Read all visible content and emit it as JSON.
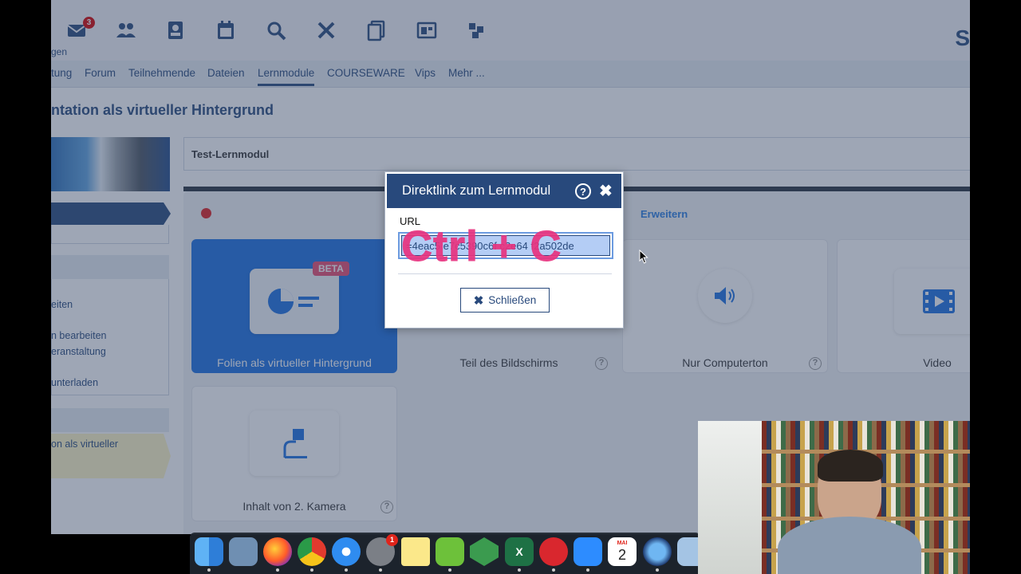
{
  "topbar": {
    "mail_badge": "3",
    "sub_label": "gen",
    "logo_text": "S",
    "icons": [
      "mail-icon",
      "people-icon",
      "profile-icon",
      "calendar-icon",
      "search-icon",
      "tools-icon",
      "files-icon",
      "admin-icon",
      "groups-icon"
    ]
  },
  "nav": {
    "tabs": [
      {
        "label": "tung"
      },
      {
        "label": "Forum"
      },
      {
        "label": "Teilnehmende"
      },
      {
        "label": "Dateien"
      },
      {
        "label": "Lernmodule",
        "active": true
      },
      {
        "label": "COURSEWARE"
      },
      {
        "label": "Vips"
      },
      {
        "label": "Mehr ..."
      }
    ]
  },
  "page": {
    "title": "ntation als virtueller Hintergrund"
  },
  "sidebar": {
    "links": [
      "eiten",
      "n bearbeiten",
      "eranstaltung",
      "unterladen"
    ],
    "selected_item": "on als virtueller"
  },
  "module": {
    "name": "Test-Lernmodul",
    "erweitern": "Erweitern",
    "beta": "BETA",
    "cards": [
      {
        "label": "Folien als virtueller Hintergrund",
        "selected": true
      },
      {
        "label": "Teil des Bildschirms"
      },
      {
        "label": "Nur Computerton"
      },
      {
        "label": "Video"
      },
      {
        "label": "Inhalt von 2. Kamera"
      }
    ]
  },
  "dialog": {
    "title": "Direktlink zum Lernmodul",
    "help": "?",
    "close_x": "✖",
    "url_label": "URL",
    "url_value": "=4eac5 e7c5390c6f c2e64 f2a502de",
    "overlay_text": "Ctrl + C",
    "close_button": "Schließen",
    "close_button_icon": "✖"
  },
  "dock": {
    "apps": [
      "Finder",
      "Preview",
      "Firefox",
      "Chrome",
      "Safari",
      "System Preferences",
      "Notes",
      "Camtasia",
      "Affinity",
      "Excel",
      "Messages",
      "Zoom",
      "Calendar",
      "Screen Recorder",
      "Photos"
    ],
    "calendar_month": "MAI",
    "calendar_day": "2",
    "prefs_badge": "1"
  },
  "colors": {
    "brand": "#28497c",
    "accent": "#1b6fe0",
    "overlay_text": "#e8337f",
    "dim": "rgba(53,70,100,0.48)"
  }
}
